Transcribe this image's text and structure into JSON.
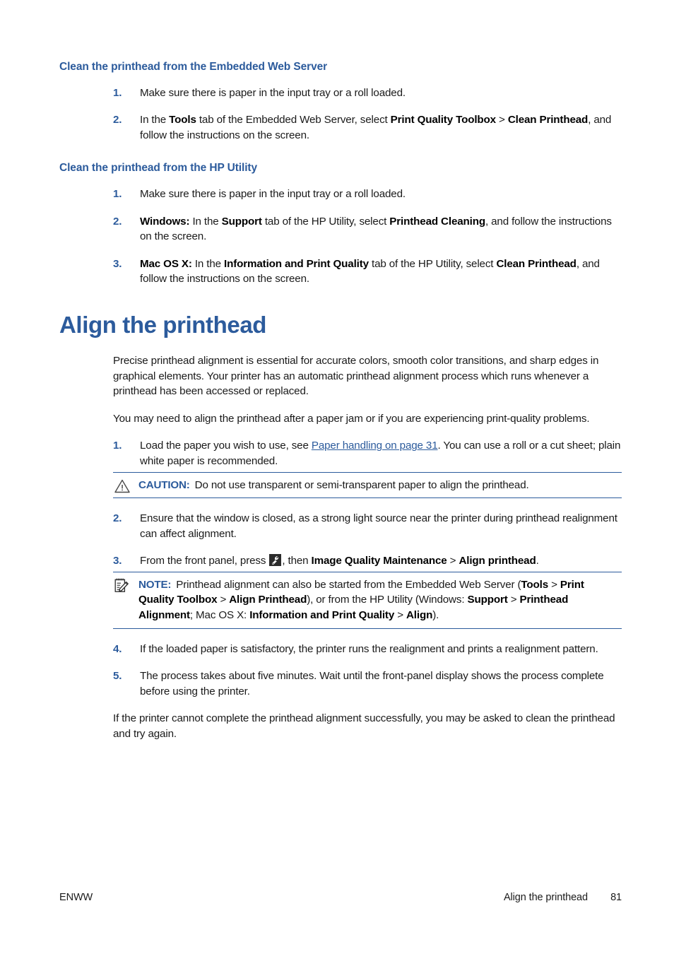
{
  "document": {
    "page_number": "81",
    "footer_left": "ENWW",
    "footer_title": "Align the printhead"
  },
  "colors": {
    "heading_blue": "#2c5b9c",
    "rule_blue": "#2c5b9c",
    "link_blue": "#2c5b9c",
    "body_text": "#1a1a1a"
  },
  "sections": {
    "ews": {
      "heading": "Clean the printhead from the Embedded Web Server",
      "steps": [
        {
          "num": "1.",
          "html": "Make sure there is paper in the input tray or a roll loaded."
        },
        {
          "num": "2.",
          "html": "In the <b>Tools</b> tab of the Embedded Web Server, select <b>Print Quality Toolbox</b> &gt; <b>Clean Printhead</b>, and follow the instructions on the screen."
        }
      ]
    },
    "hputility": {
      "heading": "Clean the printhead from the HP Utility",
      "steps": [
        {
          "num": "1.",
          "html": "Make sure there is paper in the input tray or a roll loaded."
        },
        {
          "num": "2.",
          "html": "<b>Windows:</b> In the <b>Support</b> tab of the HP Utility, select <b>Printhead Cleaning</b>, and follow the instructions on the screen."
        },
        {
          "num": "3.",
          "html": "<b>Mac OS X:</b> In the <b>Information and Print Quality</b> tab of the HP Utility, select <b>Clean Printhead</b>, and follow the instructions on the screen."
        }
      ]
    },
    "align": {
      "heading": "Align the printhead",
      "intro_paragraphs": [
        "Precise printhead alignment is essential for accurate colors, smooth color transitions, and sharp edges in graphical elements. Your printer has an automatic printhead alignment process which runs whenever a printhead has been accessed or replaced.",
        "You may need to align the printhead after a paper jam or if you are experiencing print-quality problems."
      ],
      "step1": {
        "num": "1.",
        "html": "Load the paper you wish to use, see <a class=\"link\" data-name=\"paper-handling-link\" data-interactable=\"true\">Paper handling on page 31</a>. You can use a roll or a cut sheet; plain white paper is recommended."
      },
      "caution": {
        "icon": "warning-triangle-icon",
        "label": "CAUTION:",
        "text": "Do not use transparent or semi-transparent paper to align the printhead."
      },
      "step2": {
        "num": "2.",
        "html": "Ensure that the window is closed, as a strong light source near the printer during printhead realignment can affect alignment."
      },
      "step3": {
        "num": "3.",
        "prefix": "From the front panel, press ",
        "icon": "front-panel-tools-icon",
        "suffix_html": ", then <b>Image Quality Maintenance</b> &gt; <b>Align printhead</b>."
      },
      "note": {
        "icon": "note-pad-pencil-icon",
        "label": "NOTE:",
        "html": "Printhead alignment can also be started from the Embedded Web Server (<b>Tools</b> &gt; <b>Print Quality Toolbox</b> &gt; <b>Align Printhead</b>), or from the HP Utility (Windows: <b>Support</b> &gt; <b>Printhead Alignment</b>; Mac OS X: <b>Information and Print Quality</b> &gt; <b>Align</b>)."
      },
      "step4": {
        "num": "4.",
        "html": "If the loaded paper is satisfactory, the printer runs the realignment and prints a realignment pattern."
      },
      "step5": {
        "num": "5.",
        "html": "The process takes about five minutes. Wait until the front-panel display shows the process complete before using the printer."
      },
      "closing_paragraph": "If the printer cannot complete the printhead alignment successfully, you may be asked to clean the printhead and try again."
    }
  }
}
